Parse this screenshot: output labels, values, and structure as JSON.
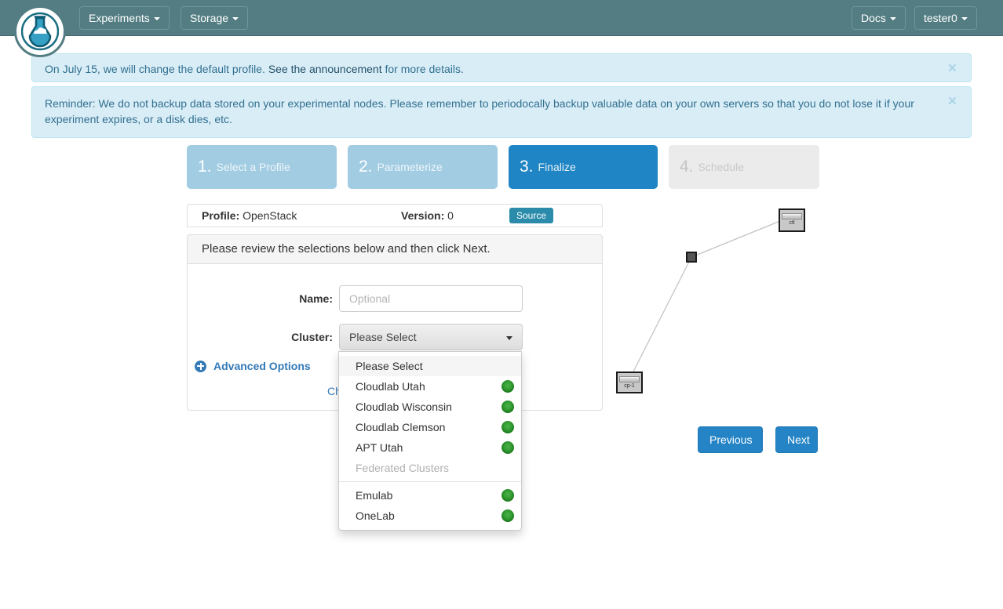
{
  "navbar": {
    "logo_icon": "flask-cloud-logo-icon",
    "items": [
      {
        "label": "Experiments",
        "icon": "caret-down-icon"
      },
      {
        "label": "Storage",
        "icon": "caret-down-icon"
      }
    ],
    "right_items": [
      {
        "label": "Docs",
        "icon": "caret-down-icon"
      },
      {
        "label": "tester0",
        "icon": "caret-down-icon"
      }
    ],
    "background_color": "#537d82"
  },
  "alerts": [
    {
      "id": "announcement",
      "text_before": "On July 15, we will change the default profile.",
      "link_text": "See the announcement",
      "text_after": "for more details.",
      "close_icon": "close-icon",
      "background_color": "#d9edf7",
      "text_color": "#31708f"
    },
    {
      "id": "reminder",
      "text": "Reminder: We do not backup data stored on your experimental nodes. Please remember to periodocally backup valuable data on your own servers so that you do not lose it if your experiment expires, or a disk dies, etc.",
      "close_icon": "close-icon"
    }
  ],
  "wizard": {
    "steps": [
      {
        "num": "1.",
        "label": "Select a Profile",
        "state": "done"
      },
      {
        "num": "2.",
        "label": "Parameterize",
        "state": "done"
      },
      {
        "num": "3.",
        "label": "Finalize",
        "state": "active"
      },
      {
        "num": "4.",
        "label": "Schedule",
        "state": "todo"
      }
    ],
    "active_color": "#1f85c4",
    "done_color": "#a2cce2",
    "todo_color": "#ebebeb"
  },
  "profile_bar": {
    "profile_label": "Profile:",
    "profile_value": "OpenStack",
    "version_label": "Version:",
    "version_value": "0",
    "source_button": "Source",
    "source_button_color": "#2a8bab"
  },
  "review_message": "Please review the selections below and then click Next.",
  "form": {
    "name": {
      "label": "Name:",
      "value": "",
      "placeholder": "Optional"
    },
    "cluster": {
      "label": "Cluster:",
      "selected": "Please Select",
      "caret_icon": "caret-down-icon"
    },
    "advanced_options": {
      "label": "Advanced Options",
      "icon": "plus-circle-icon"
    },
    "change_link": "Change Profile"
  },
  "cluster_dropdown": {
    "open": true,
    "items": [
      {
        "label": "Please Select",
        "type": "option",
        "highlighted": true,
        "status": null
      },
      {
        "label": "Cloudlab Utah",
        "type": "option",
        "highlighted": false,
        "status": "available"
      },
      {
        "label": "Cloudlab Wisconsin",
        "type": "option",
        "highlighted": false,
        "status": "available"
      },
      {
        "label": "Cloudlab Clemson",
        "type": "option",
        "highlighted": false,
        "status": "available"
      },
      {
        "label": "APT Utah",
        "type": "option",
        "highlighted": false,
        "status": "available"
      },
      {
        "label": "Federated Clusters",
        "type": "header",
        "highlighted": false,
        "status": null
      },
      {
        "label": "Emulab",
        "type": "option",
        "highlighted": false,
        "status": "available"
      },
      {
        "label": "OneLab",
        "type": "option",
        "highlighted": false,
        "status": "available"
      }
    ],
    "status_dot_color": "#2d9a2d"
  },
  "topology": {
    "nodes": [
      {
        "id": "ctl",
        "label": "ctl",
        "icon": "server-node-icon"
      },
      {
        "id": "cp-1",
        "label": "cp-1",
        "icon": "server-node-icon"
      }
    ],
    "lan": {
      "id": "lan-0",
      "icon": "lan-square-icon"
    }
  },
  "footer_buttons": {
    "previous": "Previous",
    "next": "Next",
    "color": "#2484c6"
  }
}
